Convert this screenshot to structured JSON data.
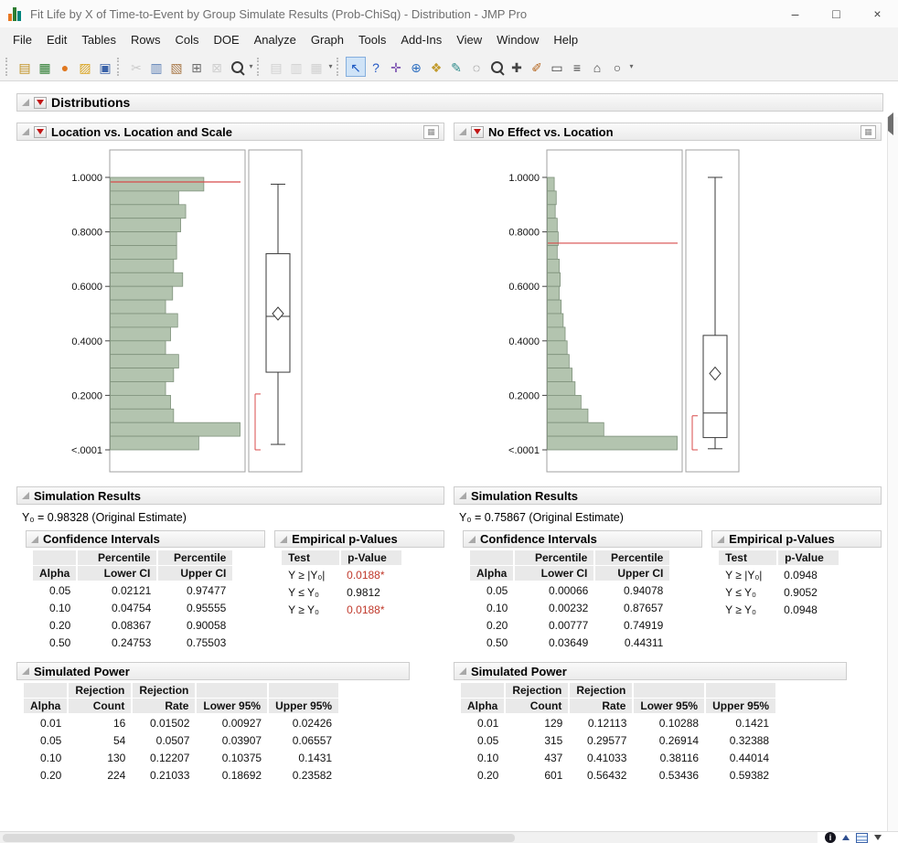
{
  "window": {
    "title": "Fit Life by X of Time-to-Event by Group Simulate Results (Prob-ChiSq) - Distribution - JMP Pro",
    "controls": {
      "minimize": "–",
      "maximize": "□",
      "close": "×"
    }
  },
  "menu": {
    "items": [
      "File",
      "Edit",
      "Tables",
      "Rows",
      "Cols",
      "DOE",
      "Analyze",
      "Graph",
      "Tools",
      "Add-Ins",
      "View",
      "Window",
      "Help"
    ]
  },
  "toolbar": {
    "groups": [
      {
        "items": [
          {
            "name": "new-journal",
            "glyph": "▤",
            "color": "#c09020"
          },
          {
            "name": "new-data-table",
            "glyph": "▦",
            "color": "#2e7d32"
          },
          {
            "name": "new-script",
            "glyph": "●",
            "color": "#e07820"
          },
          {
            "name": "open",
            "glyph": "▨",
            "color": "#d9a21b"
          },
          {
            "name": "save",
            "glyph": "▣",
            "color": "#3a62a8"
          }
        ]
      },
      {
        "items": [
          {
            "name": "cut",
            "glyph": "✂",
            "color": "#8a8a8a",
            "disabled": true
          },
          {
            "name": "copy",
            "glyph": "▥",
            "color": "#5b7fb4"
          },
          {
            "name": "paste",
            "glyph": "▧",
            "color": "#a87848"
          },
          {
            "name": "screen-capture",
            "glyph": "⊞",
            "color": "#6f6f6f"
          },
          {
            "name": "lock",
            "glyph": "⊠",
            "color": "#999999",
            "disabled": true
          },
          {
            "name": "search",
            "type": "mag",
            "dropdown": true
          }
        ]
      },
      {
        "items": [
          {
            "name": "journal-page",
            "glyph": "▤",
            "color": "#9a9a9a",
            "disabled": true
          },
          {
            "name": "layout",
            "glyph": "▥",
            "color": "#9a9a9a",
            "disabled": true
          },
          {
            "name": "print-preview",
            "glyph": "▦",
            "color": "#9a9a9a",
            "disabled": true,
            "dropdown": true
          }
        ]
      },
      {
        "items": [
          {
            "name": "arrow-tool",
            "glyph": "↖",
            "color": "#1a57c2",
            "active": true
          },
          {
            "name": "help-tool",
            "glyph": "?",
            "color": "#2458c4"
          },
          {
            "name": "crosshair-tool",
            "glyph": "✛",
            "color": "#7a4fb0"
          },
          {
            "name": "globe-tool",
            "glyph": "⊕",
            "color": "#2e6fc0"
          },
          {
            "name": "grabber-tool",
            "glyph": "❖",
            "color": "#c29b2e"
          },
          {
            "name": "brush-tool",
            "glyph": "✎",
            "color": "#2e8b8b"
          },
          {
            "name": "lasso-tool",
            "glyph": "◌",
            "color": "#555555"
          },
          {
            "name": "magnifier-tool",
            "type": "mag"
          },
          {
            "name": "plus-tool",
            "glyph": "✚",
            "color": "#444444"
          },
          {
            "name": "pencil-tool",
            "glyph": "✐",
            "color": "#b5651d"
          },
          {
            "name": "annotate-tool",
            "glyph": "▭",
            "color": "#444444"
          },
          {
            "name": "line-tool",
            "glyph": "≡",
            "color": "#444444"
          },
          {
            "name": "polygon-tool",
            "glyph": "⌂",
            "color": "#444444"
          },
          {
            "name": "oval-tool",
            "glyph": "○",
            "color": "#444444",
            "dropdown": true
          }
        ]
      }
    ]
  },
  "outline_root": {
    "title": "Distributions"
  },
  "status_bar": {
    "icons": [
      "info-icon",
      "caret-up-icon",
      "datatable-icon",
      "dropdown-icon"
    ]
  },
  "panels": [
    {
      "title": "Location vs. Location and Scale",
      "sim_results_title": "Simulation Results",
      "estimate": "Y₀ = 0.98328 (Original Estimate)",
      "ci": {
        "title": "Confidence Intervals",
        "headers": {
          "alpha": "Alpha",
          "percentile": "Percentile",
          "lower": "Lower CI",
          "upper": "Upper CI"
        },
        "rows": [
          [
            "0.05",
            "0.02121",
            "0.97477"
          ],
          [
            "0.10",
            "0.04754",
            "0.95555"
          ],
          [
            "0.20",
            "0.08367",
            "0.90058"
          ],
          [
            "0.50",
            "0.24753",
            "0.75503"
          ]
        ]
      },
      "pvalues": {
        "title": "Empirical p-Values",
        "headers": {
          "test": "Test",
          "p": "p-Value"
        },
        "rows": [
          [
            "Y ≥ |Y₀|",
            "0.0188*"
          ],
          [
            "Y ≤ Y₀",
            "0.9812"
          ],
          [
            "Y ≥ Y₀",
            "0.0188*"
          ]
        ]
      },
      "power": {
        "title": "Simulated Power",
        "headers": {
          "alpha": "Alpha",
          "rejection": "Rejection",
          "count": "Count",
          "rate": "Rate",
          "lower": "Lower 95%",
          "upper": "Upper 95%"
        },
        "rows": [
          [
            "0.01",
            "16",
            "0.01502",
            "0.00927",
            "0.02426"
          ],
          [
            "0.05",
            "54",
            "0.0507",
            "0.03907",
            "0.06557"
          ],
          [
            "0.10",
            "130",
            "0.12207",
            "0.10375",
            "0.1431"
          ],
          [
            "0.20",
            "224",
            "0.21033",
            "0.18692",
            "0.23582"
          ]
        ]
      },
      "chart_data": {
        "type": "histogram+boxplot",
        "orientation": "horizontal",
        "value_range": [
          0,
          1
        ],
        "axis_ticks": [
          {
            "v": 1.0,
            "label": "1.0000"
          },
          {
            "v": 0.8,
            "label": "0.8000"
          },
          {
            "v": 0.6,
            "label": "0.6000"
          },
          {
            "v": 0.4,
            "label": "0.4000"
          },
          {
            "v": 0.2,
            "label": "0.2000"
          },
          {
            "v": 0.0,
            "label": "<.0001"
          }
        ],
        "reference_line": 0.98328,
        "histogram": {
          "bin_width": 0.05,
          "order": "high-to-low",
          "rel_freq": [
            93,
            68,
            75,
            70,
            66,
            66,
            63,
            72,
            62,
            55,
            67,
            60,
            55,
            68,
            63,
            55,
            60,
            63,
            129,
            88
          ]
        },
        "boxplot": {
          "whisker_low": 0.02,
          "q1": 0.285,
          "median": 0.49,
          "mean": 0.5,
          "q3": 0.72,
          "whisker_high": 0.975,
          "shortest_half": [
            0.0,
            0.205
          ]
        }
      }
    },
    {
      "title": "No Effect vs. Location",
      "sim_results_title": "Simulation Results",
      "estimate": "Y₀ = 0.75867 (Original Estimate)",
      "ci": {
        "title": "Confidence Intervals",
        "headers": {
          "alpha": "Alpha",
          "percentile": "Percentile",
          "lower": "Lower CI",
          "upper": "Upper CI"
        },
        "rows": [
          [
            "0.05",
            "0.00066",
            "0.94078"
          ],
          [
            "0.10",
            "0.00232",
            "0.87657"
          ],
          [
            "0.20",
            "0.00777",
            "0.74919"
          ],
          [
            "0.50",
            "0.03649",
            "0.44311"
          ]
        ]
      },
      "pvalues": {
        "title": "Empirical p-Values",
        "headers": {
          "test": "Test",
          "p": "p-Value"
        },
        "rows": [
          [
            "Y ≥ |Y₀|",
            "0.0948"
          ],
          [
            "Y ≤ Y₀",
            "0.9052"
          ],
          [
            "Y ≥ Y₀",
            "0.0948"
          ]
        ]
      },
      "power": {
        "title": "Simulated Power",
        "headers": {
          "alpha": "Alpha",
          "rejection": "Rejection",
          "count": "Count",
          "rate": "Rate",
          "lower": "Lower 95%",
          "upper": "Upper 95%"
        },
        "rows": [
          [
            "0.01",
            "129",
            "0.12113",
            "0.10288",
            "0.1421"
          ],
          [
            "0.05",
            "315",
            "0.29577",
            "0.26914",
            "0.32388"
          ],
          [
            "0.10",
            "437",
            "0.41033",
            "0.38116",
            "0.44014"
          ],
          [
            "0.20",
            "601",
            "0.56432",
            "0.53436",
            "0.59382"
          ]
        ]
      },
      "chart_data": {
        "type": "histogram+boxplot",
        "orientation": "horizontal",
        "value_range": [
          0,
          1
        ],
        "axis_ticks": [
          {
            "v": 1.0,
            "label": "1.0000"
          },
          {
            "v": 0.8,
            "label": "0.8000"
          },
          {
            "v": 0.6,
            "label": "0.6000"
          },
          {
            "v": 0.4,
            "label": "0.4000"
          },
          {
            "v": 0.2,
            "label": "0.2000"
          },
          {
            "v": 0.0,
            "label": "<.0001"
          }
        ],
        "reference_line": 0.75867,
        "histogram": {
          "bin_width": 0.05,
          "order": "high-to-low",
          "rel_freq": [
            7,
            9,
            8,
            10,
            11,
            10,
            12,
            13,
            12,
            14,
            16,
            18,
            20,
            22,
            25,
            28,
            34,
            41,
            57,
            131
          ]
        },
        "boxplot": {
          "whisker_low": 0.004,
          "q1": 0.045,
          "median": 0.135,
          "mean": 0.28,
          "q3": 0.42,
          "whisker_high": 1.0,
          "shortest_half": [
            0.0,
            0.125
          ]
        }
      }
    }
  ],
  "colors": {
    "hist_fill": "#b3c4af",
    "hist_border": "#7e917b",
    "reference_line": "#d84b4b",
    "significant_text": "#c0392b",
    "red_triangle": "#c11616",
    "header_bar_bg": "#ebebeb"
  }
}
